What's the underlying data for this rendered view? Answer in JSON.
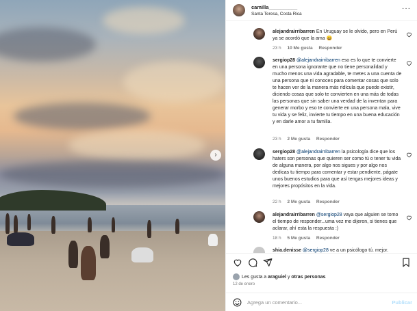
{
  "photo": {
    "next_icon": "chevron-right-icon",
    "next_glyph": "›"
  },
  "post_header": {
    "username": "camilla__________",
    "location": "Santa Teresa, Costa Rica",
    "more_glyph": "···"
  },
  "comments": [
    {
      "user": "alejandrairribarren",
      "text": "En Uruguay se le olvido, pero en Perú ya se acordó que la ama 😄",
      "time": "23 h",
      "likes": "10 Me gusta",
      "reply": "Responder"
    },
    {
      "user": "sergiop28",
      "mention": "@alejandrairribarren",
      "text": "eso es lo que te convierte en una persona ignorante que no tiene personalidad y mucho menos una vida agradable, te metes a una cuenta de una persona que ni conoces para comentar cosas que solo te hacen ver de la manera más ridícula que puede existir, diciendo cosas que solo te convierten en una más de todas las personas que sin saber una verdad de la inventan para generar morbo y eso te convierte en una persona mala, vive tu vida y se feliz, invierte tu tiempo en una buena educación y en darle amor a tu familia.",
      "time": "23 h",
      "likes": "2 Me gusta",
      "reply": "Responder"
    },
    {
      "user": "sergiop28",
      "mention": "@alejandrairribarren",
      "text": "la psicología dice que los haters son personas que quieren ser como tú o tener tu vida de alguna manera, por algo nos sigues y por algo nos dedicas tu tiempo para comentar y estar pendiente, págate unos buenos estudios para que así tengas mejores ideas y mejores propósitos en la vida.",
      "time": "22 h",
      "likes": "2 Me gusta",
      "reply": "Responder"
    },
    {
      "user": "alejandrairribarren",
      "mention": "@sergiop28",
      "text": "vaya que alguien se tomo el tiempo de responder...uma vez me dijeron, si tienes que aclarar, ahí esta la respuesta :)",
      "time": "18 h",
      "likes": "5 Me gusta",
      "reply": "Responder"
    },
    {
      "user": "shia.denisse",
      "mention": "@sergiop28",
      "text": "ve a un psicólogo tú. mejor."
    }
  ],
  "actions": {
    "like_icon": "heart-icon",
    "comment_icon": "comment-icon",
    "share_icon": "share-icon",
    "save_icon": "bookmark-icon"
  },
  "likes_line": {
    "prefix": "Les gusta a ",
    "user": "araguiel",
    "middle": " y ",
    "rest": "otras personas"
  },
  "date": "12 de enero",
  "composer": {
    "placeholder": "Agrega un comentario...",
    "post_label": "Publicar"
  }
}
